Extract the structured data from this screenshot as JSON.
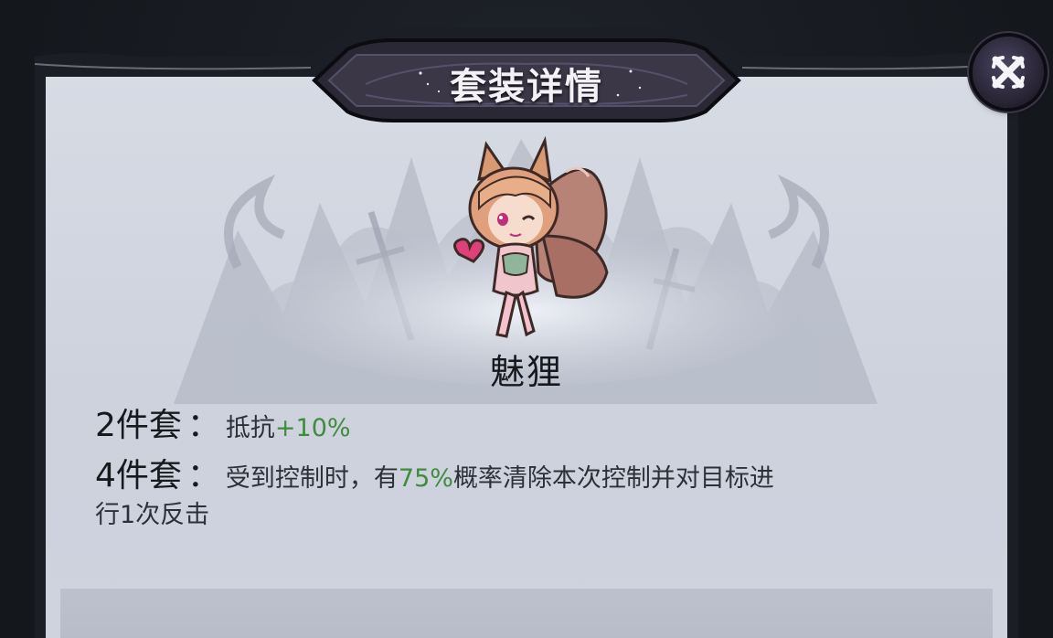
{
  "header": {
    "title": "套装详情"
  },
  "close_button": {
    "icon": "close-x-icon"
  },
  "set": {
    "name": "魅狸",
    "character_icon": "fox-girl-portrait"
  },
  "bonuses": [
    {
      "label": "2件套",
      "separator": "：",
      "text_before": "抵抗",
      "highlight": "+10%",
      "text_after": ""
    },
    {
      "label": "4件套",
      "separator": "：",
      "text_before": "受到控制时，有",
      "highlight": "75%",
      "text_after": "概率清除本次控制并对目标进",
      "text_line2": "行1次反击"
    }
  ],
  "colors": {
    "highlight_green": "#3e8c3e",
    "panel_bg": "#d3d7e1",
    "frame_dark": "#1b1e24"
  }
}
